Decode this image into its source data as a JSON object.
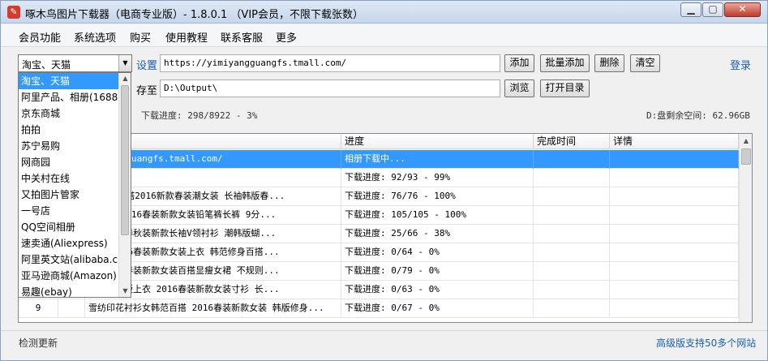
{
  "window": {
    "title": "啄木鸟图片下载器（电商专业版）- 1.8.0.1 （VIP会员，不限下载张数）",
    "icon_name": "woodpecker-logo-icon"
  },
  "menu": [
    "会员功能",
    "系统选项",
    "购买",
    "使用教程",
    "联系客服",
    "更多"
  ],
  "toolbar": {
    "site_selected": "淘宝、天猫",
    "settings_label": "设置",
    "url_value": "https://yimiyangguangfs.tmall.com/",
    "add_label": "添加",
    "batch_add_label": "批量添加",
    "delete_label": "删除",
    "clear_label": "清空",
    "login_label": "登录",
    "save_label": "存至",
    "save_path": "D:\\Output\\",
    "browse_label": "浏览",
    "open_dir_label": "打开目录",
    "progress_text": "下载进度: 298/8922 - 3%",
    "disk_text": "D:盘剩余空间: 62.96GB"
  },
  "dropdown": {
    "items": [
      "淘宝、天猫",
      "阿里产品、相册(1688)",
      "京东商城",
      "拍拍",
      "苏宁易购",
      "网商园",
      "中关村在线",
      "又拍图片管家",
      "一号店",
      "QQ空间相册",
      "速卖通(Aliexpress)",
      "阿里英文站(alibaba.c",
      "亚马逊商城(Amazon)",
      "易趣(ebay)"
    ],
    "selected_index": 0
  },
  "table": {
    "headers": [
      "",
      "",
      "",
      "进度",
      "完成时间",
      "详情"
    ],
    "rows": [
      {
        "num": "",
        "flag": "",
        "name": "imiyangguangfs.tmall.com/",
        "progress": "相册下载中...",
        "time": "",
        "detail": "",
        "selected": true
      },
      {
        "num": "",
        "flag": "",
        "name": "",
        "progress": "下载进度: 92/93 - 99%",
        "time": "",
        "detail": "",
        "selected": false
      },
      {
        "num": "",
        "flag": "",
        "name": "' 韩范百搭2016新款春装潮女装 长袖韩版春...",
        "progress": "下载进度: 76/76 - 100%",
        "time": "",
        "detail": "",
        "selected": false
      },
      {
        "num": "",
        "flag": "",
        "name": "休闲裤 2016春装新款女装铅笔裤长裤 9分...",
        "progress": "下载进度: 105/105 - 100%",
        "time": "",
        "detail": "",
        "selected": false
      },
      {
        "num": "",
        "flag": "",
        "name": "范 2016春秋装新款长袖V领衬衫 潮韩版蝴...",
        "progress": "下载进度: 25/66 - 38%",
        "time": "",
        "detail": "",
        "selected": false
      },
      {
        "num": "",
        "flag": "",
        "name": "衣女 2016春装新款女装上衣 韩范修身百搭...",
        "progress": "下载进度: 0/64 - 0%",
        "time": "",
        "detail": "",
        "selected": false
      },
      {
        "num": "",
        "flag": "",
        "name": "夏 2016春装新款女装百搭显瘦女裙 不规则...",
        "progress": "下载进度: 0/79 - 0%",
        "time": "",
        "detail": "",
        "selected": false
      },
      {
        "num": "",
        "flag": "",
        "name": "韩范宽松版上衣 2016春装新款女装寸衫 长...",
        "progress": "下载进度: 0/63 - 0%",
        "time": "",
        "detail": "",
        "selected": false
      },
      {
        "num": "9",
        "flag": "",
        "name": "雪纺印花衬衫女韩范百搭 2016春装新款女装 韩版修身...",
        "progress": "下载进度: 0/67 - 0%",
        "time": "",
        "detail": "",
        "selected": false
      }
    ]
  },
  "status": {
    "left": "检测更新",
    "right": "高级版支持50多个网站"
  }
}
